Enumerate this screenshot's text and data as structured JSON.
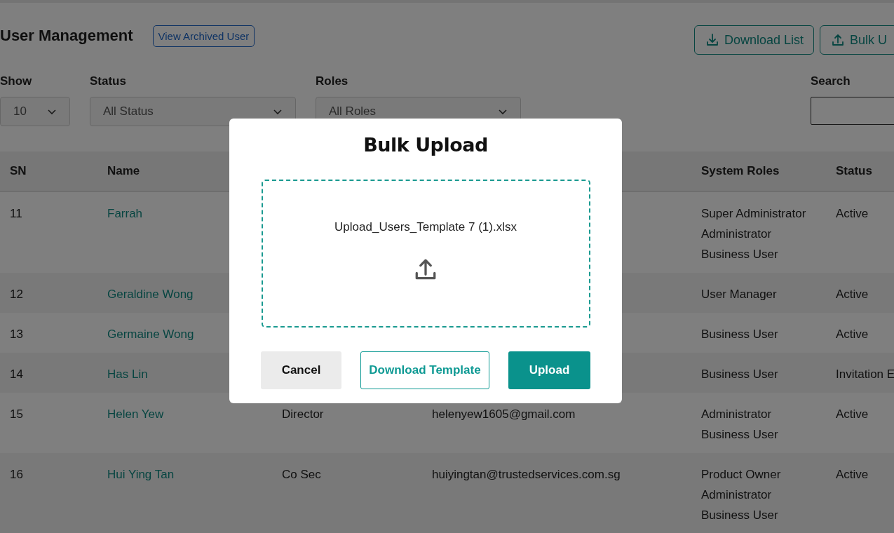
{
  "page": {
    "title": "User Management",
    "archived_button": "View Archived User",
    "actions": [
      {
        "label": "Download List",
        "kind": "download"
      },
      {
        "label": "Bulk U",
        "kind": "upload"
      }
    ]
  },
  "filters": {
    "show": {
      "label": "Show",
      "value": "10"
    },
    "status": {
      "label": "Status",
      "value": "All Status"
    },
    "roles": {
      "label": "Roles",
      "value": "All Roles"
    },
    "search": {
      "label": "Search"
    }
  },
  "table": {
    "columns": {
      "sn": "SN",
      "name": "Name",
      "system_roles": "System Roles",
      "status": "Status"
    },
    "rows": [
      {
        "sn": "11",
        "name": "Farrah",
        "system_roles": [
          "Super Administrator",
          "Administrator",
          "Business User"
        ],
        "status": "Active"
      },
      {
        "sn": "12",
        "name": "Geraldine Wong",
        "system_roles": [
          "User Manager"
        ],
        "status": "Active"
      },
      {
        "sn": "13",
        "name": "Germaine Wong",
        "system_roles": [
          "Business User"
        ],
        "status": "Active"
      },
      {
        "sn": "14",
        "name": "Has Lin",
        "system_roles": [
          "Business User"
        ],
        "status": "Invitation E"
      },
      {
        "sn": "15",
        "name": "Helen Yew",
        "column_3": "Director",
        "column_4": "helenyew1605@gmail.com",
        "system_roles": [
          "Administrator",
          "Business User"
        ],
        "status": "Active"
      },
      {
        "sn": "16",
        "name": "Hui Ying Tan",
        "column_3": "Co Sec",
        "column_4": "huiyingtan@trustedservices.com.sg",
        "system_roles": [
          "Product Owner",
          "Administrator",
          "Business User"
        ],
        "status": "Active"
      }
    ]
  },
  "modal": {
    "title": "Bulk Upload",
    "file_name": "Upload_Users_Template 7 (1).xlsx",
    "buttons": [
      {
        "label": "Cancel",
        "kind": "secondary"
      },
      {
        "label": "Download Template",
        "kind": "outline"
      },
      {
        "label": "Upload",
        "kind": "primary"
      }
    ]
  }
}
